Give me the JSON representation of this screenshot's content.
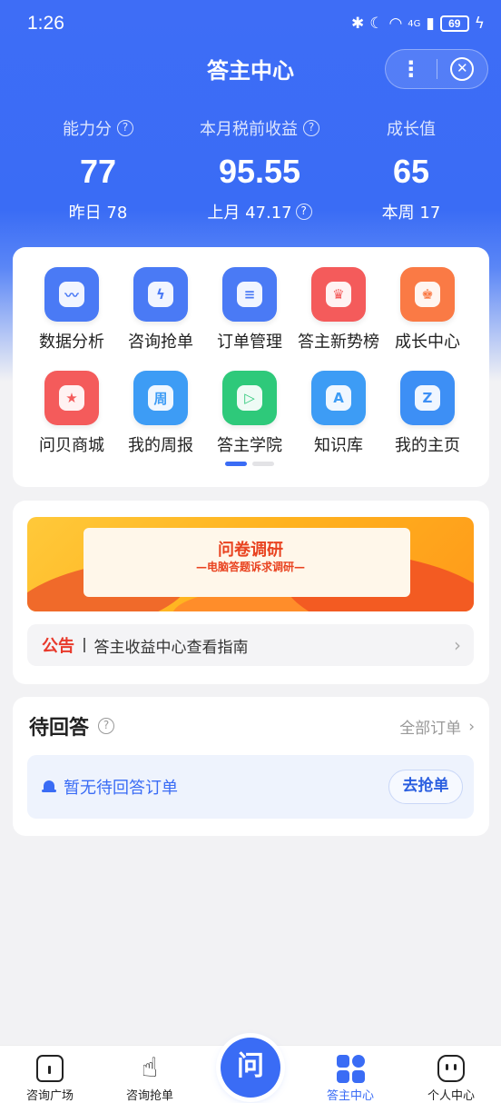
{
  "status_bar": {
    "time": "1:26",
    "network": "4G",
    "battery": "69"
  },
  "header": {
    "title": "答主中心",
    "more_icon": "more-vertical-icon",
    "close_icon": "close-circle-icon"
  },
  "stats": [
    {
      "label": "能力分",
      "value": "77",
      "sub": "昨日 78",
      "has_help": true
    },
    {
      "label": "本月税前收益",
      "value": "95.55",
      "sub": "上月 47.17",
      "has_help": true
    },
    {
      "label": "成长值",
      "value": "65",
      "sub": "本周 17",
      "has_help": false
    }
  ],
  "grid": {
    "items": [
      {
        "label": "数据分析",
        "icon": "chart-icon",
        "color": "#4a7af5",
        "glyph": "〰"
      },
      {
        "label": "咨询抢单",
        "icon": "lightning-icon",
        "color": "#4a7af5",
        "glyph": "ϟ"
      },
      {
        "label": "订单管理",
        "icon": "document-icon",
        "color": "#4a7af5",
        "glyph": "≡"
      },
      {
        "label": "答主新势榜",
        "icon": "trophy-icon",
        "color": "#f45b5b",
        "glyph": "♛"
      },
      {
        "label": "成长中心",
        "icon": "crown-icon",
        "color": "#fa7a45",
        "glyph": "♚"
      },
      {
        "label": "问贝商城",
        "icon": "shell-icon",
        "color": "#f45b5b",
        "glyph": "★"
      },
      {
        "label": "我的周报",
        "icon": "calendar-icon",
        "color": "#3d9cf5",
        "glyph": "周"
      },
      {
        "label": "答主学院",
        "icon": "video-book-icon",
        "color": "#2ec97a",
        "glyph": "▷"
      },
      {
        "label": "知识库",
        "icon": "book-icon",
        "color": "#3d9cf5",
        "glyph": "A"
      },
      {
        "label": "我的主页",
        "icon": "star-z-icon",
        "color": "#3d8ff5",
        "glyph": "Z"
      }
    ]
  },
  "banner": {
    "title": "问卷调研",
    "subtitle": "—电脑答题诉求调研—"
  },
  "notice": {
    "tag": "公告",
    "text": "答主收益中心查看指南"
  },
  "pending": {
    "title": "待回答",
    "all_orders": "全部订单",
    "empty_text": "暂无待回答订单",
    "grab_button": "去抢单"
  },
  "tabbar": {
    "tabs": [
      {
        "label": "咨询广场",
        "icon": "home-icon",
        "active": false
      },
      {
        "label": "咨询抢单",
        "icon": "tap-hand-icon",
        "active": false
      },
      {
        "label": "答主中心",
        "icon": "grid-squares-icon",
        "active": true
      },
      {
        "label": "个人中心",
        "icon": "face-icon",
        "active": false
      }
    ],
    "center_label": "问"
  },
  "colors": {
    "primary": "#3a6cf5",
    "notice_red": "#e8392b"
  }
}
